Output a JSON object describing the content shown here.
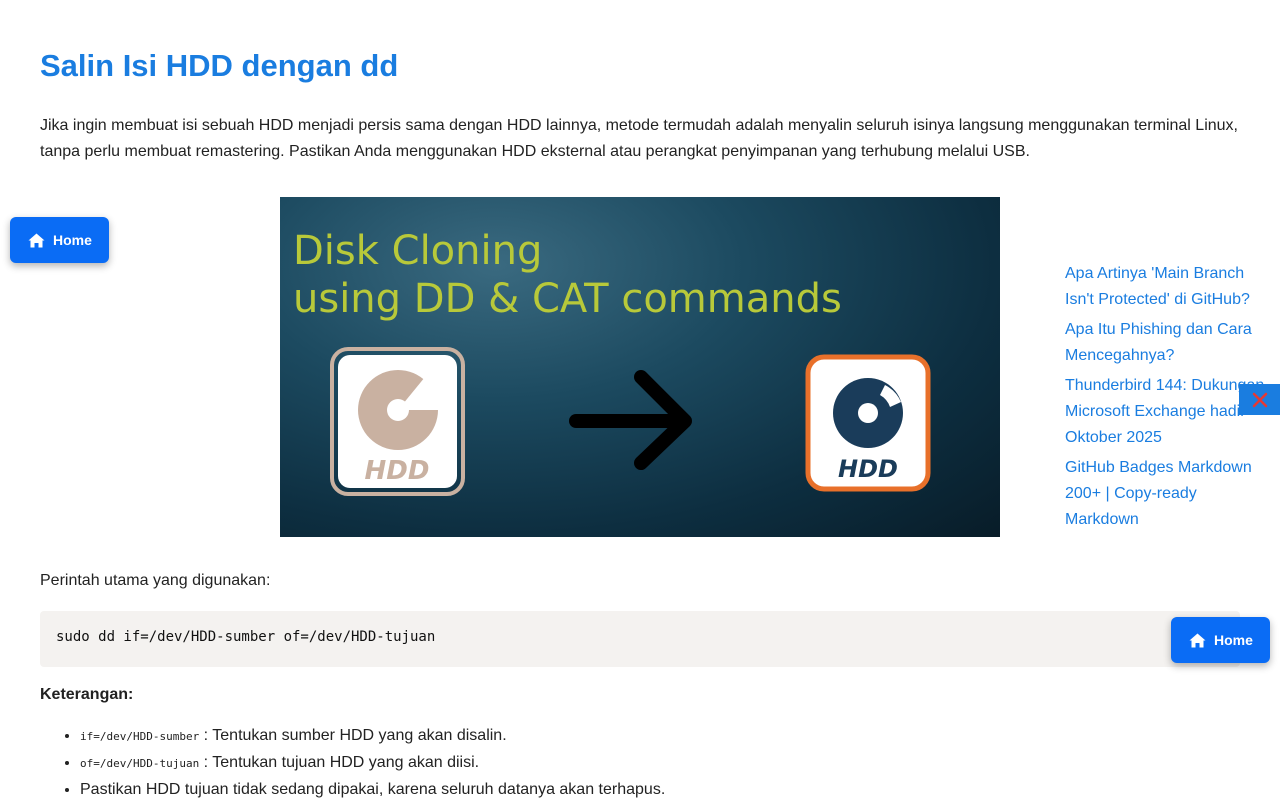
{
  "article": {
    "title": "Salin Isi HDD dengan dd",
    "intro": "Jika ingin membuat isi sebuah HDD menjadi persis sama dengan HDD lainnya, metode termudah adalah menyalin seluruh isinya langsung menggunakan terminal Linux, tanpa perlu membuat remastering. Pastikan Anda menggunakan HDD eksternal atau perangkat penyimpanan yang terhubung melalui USB.",
    "image": {
      "title_line1": "Disk Cloning",
      "title_line2": "using DD & CAT commands",
      "source_label": "HDD",
      "target_label": "HDD"
    },
    "command_intro": "Perintah utama yang digunakan:",
    "command": "sudo dd if=/dev/HDD-sumber of=/dev/HDD-tujuan",
    "notes_heading": "Keterangan:",
    "notes": [
      {
        "code": "if=/dev/HDD-sumber",
        "text": " : Tentukan sumber HDD yang akan disalin."
      },
      {
        "code": "of=/dev/HDD-tujuan",
        "text": " : Tentukan tujuan HDD yang akan diisi."
      },
      {
        "code": "",
        "text": "Pastikan HDD tujuan tidak sedang dipakai, karena seluruh datanya akan terhapus."
      }
    ]
  },
  "related_links": [
    "Apa Artinya 'Main Branch Isn't Protected' di GitHub?",
    "Apa Itu Phishing dan Cara Mencegahnya?",
    "Thunderbird 144: Dukungan Microsoft Exchange hadir Oktober 2025",
    "GitHub Badges Markdown 200+ | Copy-ready Markdown"
  ],
  "buttons": {
    "home_label": "Home"
  },
  "icons": {
    "home": "home-icon",
    "close": "close-icon"
  },
  "colors": {
    "accent": "#1a7de0",
    "button": "#0a6cf5",
    "close_x": "#e53935",
    "code_bg": "#f4f2f0",
    "hero_text": "#b8c93a",
    "hdd_source": "#c9b1a1",
    "hdd_target": "#e8702a"
  }
}
